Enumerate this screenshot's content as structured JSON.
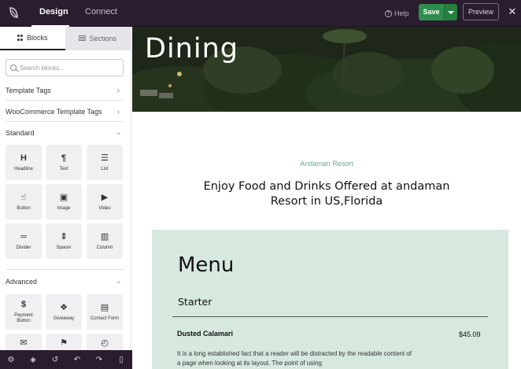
{
  "topbar": {
    "tabs": [
      {
        "label": "Design",
        "active": true
      },
      {
        "label": "Connect",
        "active": false
      }
    ],
    "help_label": "Help",
    "save_label": "Save",
    "preview_label": "Preview",
    "colors": {
      "bar": "#2a1d2f",
      "save": "#2e8d4c"
    }
  },
  "sidebar": {
    "tabs": [
      {
        "label": "Blocks",
        "icon": "grid-icon",
        "active": true
      },
      {
        "label": "Sections",
        "icon": "rows-icon",
        "active": false
      }
    ],
    "search_placeholder": "Search blocks...",
    "groups": [
      {
        "label": "Template Tags",
        "state": "collapsed"
      },
      {
        "label": "WooCommerce Template Tags",
        "state": "collapsed"
      },
      {
        "label": "Standard",
        "state": "expanded"
      },
      {
        "label": "Advanced",
        "state": "expanded"
      }
    ],
    "standard_blocks": [
      {
        "label": "Headline",
        "icon": "headline-icon",
        "glyph": "H"
      },
      {
        "label": "Text",
        "icon": "paragraph-icon",
        "glyph": "¶"
      },
      {
        "label": "List",
        "icon": "list-icon",
        "glyph": "☰"
      },
      {
        "label": "Button",
        "icon": "pointer-icon",
        "glyph": "☝"
      },
      {
        "label": "Image",
        "icon": "image-icon",
        "glyph": "▣"
      },
      {
        "label": "Video",
        "icon": "video-icon",
        "glyph": "▶"
      },
      {
        "label": "Divider",
        "icon": "divider-icon",
        "glyph": "═"
      },
      {
        "label": "Spacer",
        "icon": "spacer-icon",
        "glyph": "⇕"
      },
      {
        "label": "Column",
        "icon": "column-icon",
        "glyph": "▥"
      }
    ],
    "advanced_blocks": [
      {
        "label": "Payment Button",
        "icon": "payment-icon",
        "glyph": "$"
      },
      {
        "label": "Giveaway",
        "icon": "gift-icon",
        "glyph": "❖"
      },
      {
        "label": "Contact Form",
        "icon": "form-icon",
        "glyph": "▤"
      },
      {
        "label": "",
        "icon": "email-icon",
        "glyph": "✉"
      },
      {
        "label": "",
        "icon": "flag-icon",
        "glyph": "⚑"
      },
      {
        "label": "",
        "icon": "timer-icon",
        "glyph": "◴"
      }
    ]
  },
  "bottombar": {
    "icons": [
      "settings-icon",
      "layers-icon",
      "history-icon",
      "undo-icon",
      "redo-icon",
      "mobile-preview-icon"
    ],
    "glyphs": [
      "⚙",
      "◈",
      "↺",
      "↶",
      "↷",
      "▯"
    ]
  },
  "canvas": {
    "hero_title": "Dining",
    "subhead": "Andaman Resort",
    "heading": "Enjoy Food and Drinks Offered at andaman Resort in US,Florida",
    "menu": {
      "title": "Menu",
      "section": "Starter",
      "items": [
        {
          "name": "Dusted Calamari",
          "price": "$45.09",
          "description": "It is a long established fact that a reader will be distracted by the readable content of a page when looking at its layout. The point of using"
        }
      ]
    },
    "colors": {
      "subhead": "#6aa98a",
      "menu_bg": "#d7e8df"
    }
  }
}
